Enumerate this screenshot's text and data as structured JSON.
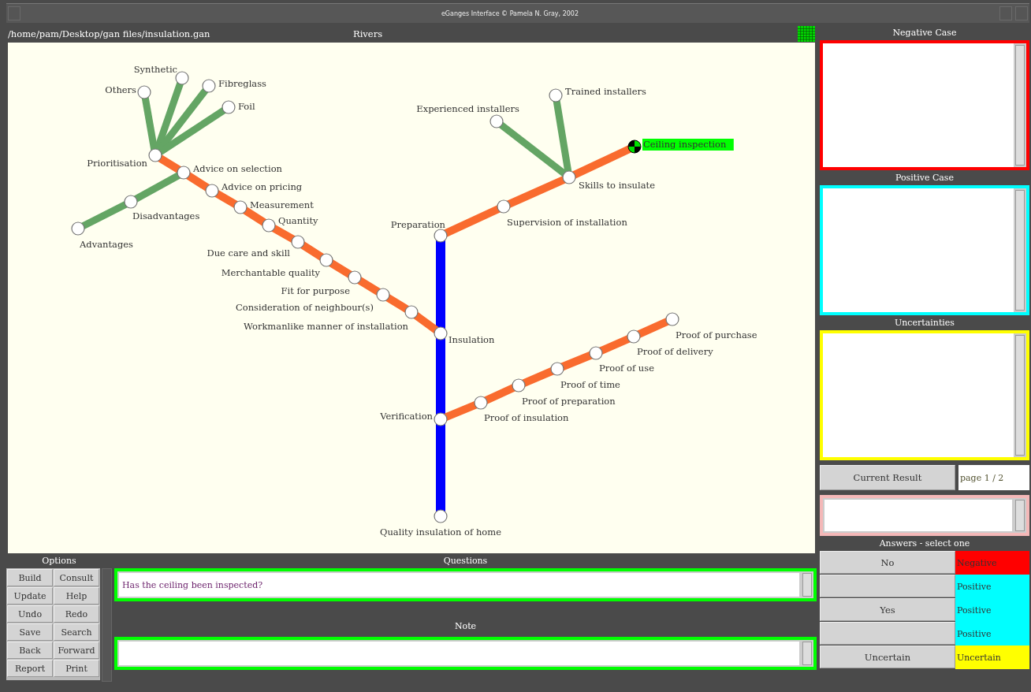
{
  "window": {
    "title": "eGanges Interface © Pamela N. Gray, 2002"
  },
  "file_path": "/home/pam/Desktop/gan files/insulation.gan",
  "map": {
    "title": "Rivers",
    "rivers": [
      {
        "kind": "main",
        "stations": [
          {
            "label": "Preparation",
            "selected": false
          },
          {
            "label": "Insulation",
            "selected": false
          },
          {
            "label": "Verification",
            "selected": false
          },
          {
            "label": "Quality insulation of home",
            "selected": false
          }
        ]
      },
      {
        "kind": "tributary",
        "stations": [
          {
            "label": "Ceiling inspection",
            "selected": true
          },
          {
            "label": "Skills to insulate",
            "selected": false
          },
          {
            "label": "Supervision of installation",
            "selected": false
          }
        ]
      },
      {
        "kind": "tributary",
        "stations": [
          {
            "label": "Prioritisation",
            "selected": false
          },
          {
            "label": "Advice on selection",
            "selected": false
          },
          {
            "label": "Advice on pricing",
            "selected": false
          },
          {
            "label": "Measurement",
            "selected": false
          },
          {
            "label": "Quantity",
            "selected": false
          },
          {
            "label": "Due care and skill",
            "selected": false
          },
          {
            "label": "Merchantable quality",
            "selected": false
          },
          {
            "label": "Fit for purpose",
            "selected": false
          },
          {
            "label": "Consideration of neighbour(s)",
            "selected": false
          },
          {
            "label": "Workmanlike manner of installation",
            "selected": false
          }
        ]
      },
      {
        "kind": "tributary",
        "stations": [
          {
            "label": "Proof of purchase",
            "selected": false
          },
          {
            "label": "Proof of delivery",
            "selected": false
          },
          {
            "label": "Proof of use",
            "selected": false
          },
          {
            "label": "Proof of time",
            "selected": false
          },
          {
            "label": "Proof of preparation",
            "selected": false
          },
          {
            "label": "Proof of insulation",
            "selected": false
          }
        ]
      },
      {
        "kind": "stream",
        "stations": [
          {
            "label": "Others",
            "selected": false
          }
        ]
      },
      {
        "kind": "stream",
        "stations": [
          {
            "label": "Synthetic",
            "selected": false
          }
        ]
      },
      {
        "kind": "stream",
        "stations": [
          {
            "label": "Fibreglass",
            "selected": false
          }
        ]
      },
      {
        "kind": "stream",
        "stations": [
          {
            "label": "Foil",
            "selected": false
          }
        ]
      },
      {
        "kind": "stream",
        "stations": [
          {
            "label": "Advantages",
            "selected": false
          },
          {
            "label": "Disadvantages",
            "selected": false
          }
        ]
      },
      {
        "kind": "stream",
        "stations": [
          {
            "label": "Experienced installers",
            "selected": false
          }
        ]
      },
      {
        "kind": "stream",
        "stations": [
          {
            "label": "Trained installers",
            "selected": false
          }
        ]
      }
    ]
  },
  "cases": [
    {
      "title": "Negative  Case",
      "color": "#ff0000"
    },
    {
      "title": "Positive  Case",
      "color": "#00ffff"
    },
    {
      "title": "Uncertainties",
      "color": "#ffff00"
    }
  ],
  "current_result": {
    "button": "Current  Result",
    "page": "page 1 / 2"
  },
  "options": {
    "title": "Options",
    "buttons": [
      "Build",
      "Consult",
      "Update",
      "Help",
      "Undo",
      "Redo",
      "Save",
      "Search",
      "Back",
      "Forward",
      "Report",
      "Print"
    ]
  },
  "questions": {
    "title": "Questions",
    "value": "Has the ceiling been inspected?"
  },
  "note": {
    "title": "Note"
  },
  "answers": {
    "title": "Answers - select one",
    "rows": [
      {
        "label": "No",
        "result": "Negative",
        "color": "#ff0000"
      },
      {
        "result": "Positive",
        "color": "#00ffff"
      },
      {
        "label": "Yes",
        "result": "Positive",
        "color": "#00ffff"
      },
      {
        "result": "Positive",
        "color": "#00ffff"
      },
      {
        "label": "Uncertain",
        "result": "Uncertain",
        "color": "#ffff00"
      }
    ]
  }
}
